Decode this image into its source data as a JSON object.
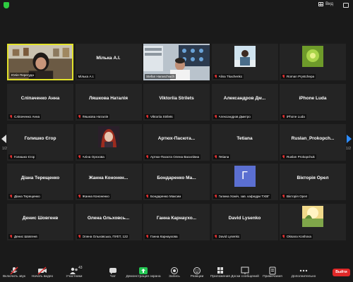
{
  "topbar": {
    "view_label": "Вид"
  },
  "pagination": {
    "left": "1/2",
    "right": "1/2"
  },
  "tiles": [
    {
      "id": "t0",
      "name": "",
      "label": "Юлія Перегуда",
      "kind": "video-woman",
      "active": true,
      "muted": false
    },
    {
      "id": "t1",
      "name": "Мілька А.І.",
      "label": "Мілька А.І.",
      "kind": "name",
      "muted": false
    },
    {
      "id": "t2",
      "name": "",
      "label": "Stefan Haraschiuch",
      "kind": "video-man",
      "muted": false
    },
    {
      "id": "t3",
      "name": "",
      "label": "Alina Tkachenko",
      "kind": "avatar-photo",
      "muted": true
    },
    {
      "id": "t4",
      "name": "",
      "label": "Roman Prystchepa",
      "kind": "avatar-green",
      "muted": true
    },
    {
      "id": "t5",
      "name": "Сліпаченко Анна",
      "label": "Сліпаченко Анна",
      "kind": "name",
      "muted": true
    },
    {
      "id": "t6",
      "name": "Ляшкова Наталія",
      "label": "Ляшкова Наталія",
      "kind": "name",
      "muted": true
    },
    {
      "id": "t7",
      "name": "Viktoriia Strilets",
      "label": "Viktoriia Strilets",
      "kind": "name",
      "muted": true
    },
    {
      "id": "t8",
      "name": "Александров Дм...",
      "label": "Александров Дмитро",
      "kind": "name",
      "muted": true
    },
    {
      "id": "t9",
      "name": "iPhone Luda",
      "label": "iPhone Luda",
      "kind": "name",
      "muted": true
    },
    {
      "id": "t10",
      "name": "Голишко Єгор",
      "label": "Голишко Єгор",
      "kind": "name",
      "muted": true
    },
    {
      "id": "t11",
      "name": "",
      "label": "Аліна Орєхова",
      "kind": "avatar-anime",
      "muted": true
    },
    {
      "id": "t12",
      "name": "Артюх-Пасюта...",
      "label": "Артюх-Пасюта Олена Василівна",
      "kind": "name",
      "muted": true
    },
    {
      "id": "t13",
      "name": "Tetiana",
      "label": "Tetiana",
      "kind": "name",
      "muted": true
    },
    {
      "id": "t14",
      "name": "Ruslan_Prokopch...",
      "label": "Ruslan Prokopchuk",
      "kind": "name",
      "muted": true
    },
    {
      "id": "t15",
      "name": "Діана Терещенко",
      "label": "Діана Терещенко",
      "kind": "name",
      "muted": true
    },
    {
      "id": "t16",
      "name": "Жанна Кононен...",
      "label": "Жанна Кононенко",
      "kind": "name",
      "muted": true
    },
    {
      "id": "t17",
      "name": "Бондаренко Ма...",
      "label": "Бондаренко Максим",
      "kind": "name",
      "muted": true
    },
    {
      "id": "t18",
      "name": "",
      "label": "Галина Хоміч, зав. кафедри ТХВГ",
      "kind": "avatar-letter",
      "letter": "Г",
      "muted": true
    },
    {
      "id": "t19",
      "name": "Вікторія Орел",
      "label": "Вікторія Орел",
      "kind": "name",
      "muted": true
    },
    {
      "id": "t20",
      "name": "Денис Шовгенв",
      "label": "Денис Шовгенв",
      "kind": "name",
      "muted": true
    },
    {
      "id": "t21",
      "name": "Олена Ольховсь...",
      "label": "Олена Ольховська, ПУЕТ, 122",
      "kind": "name",
      "muted": true
    },
    {
      "id": "t22",
      "name": "Ганна Карнаухо...",
      "label": "Ганна Карнаухова",
      "kind": "name",
      "muted": true
    },
    {
      "id": "t23",
      "name": "David Lysenko",
      "label": "David Lysenko",
      "kind": "name",
      "muted": true
    },
    {
      "id": "t24",
      "name": "",
      "label": "Oksana Koshova",
      "kind": "avatar-nature",
      "muted": true
    }
  ],
  "toolbar": {
    "items": [
      {
        "id": "mic",
        "label": "Включить звук",
        "icon": "mic-muted-icon"
      },
      {
        "id": "video",
        "label": "Начать видео",
        "icon": "video-off-icon"
      },
      {
        "id": "participants",
        "label": "Участники",
        "icon": "participants-icon",
        "count": "43"
      },
      {
        "id": "chat",
        "label": "Чат",
        "icon": "chat-icon"
      },
      {
        "id": "share",
        "label": "Демонстрация экрана",
        "icon": "share-screen-icon"
      },
      {
        "id": "record",
        "label": "Запись",
        "icon": "record-icon"
      },
      {
        "id": "reactions",
        "label": "Реакции",
        "icon": "reactions-icon"
      },
      {
        "id": "apps",
        "label": "Приложения",
        "icon": "apps-icon"
      },
      {
        "id": "whiteboard",
        "label": "Доски сообщений",
        "icon": "whiteboard-icon"
      },
      {
        "id": "notes",
        "label": "Примечания",
        "icon": "notes-icon"
      },
      {
        "id": "more",
        "label": "Дополнительно",
        "icon": "more-icon"
      }
    ],
    "leave_label": "Выйти"
  },
  "colors": {
    "active_border": "#e2e22a",
    "share_green": "#23c552",
    "leave_red": "#e02828",
    "mute_red": "#e23030",
    "nav_blue": "#2d8cff"
  }
}
